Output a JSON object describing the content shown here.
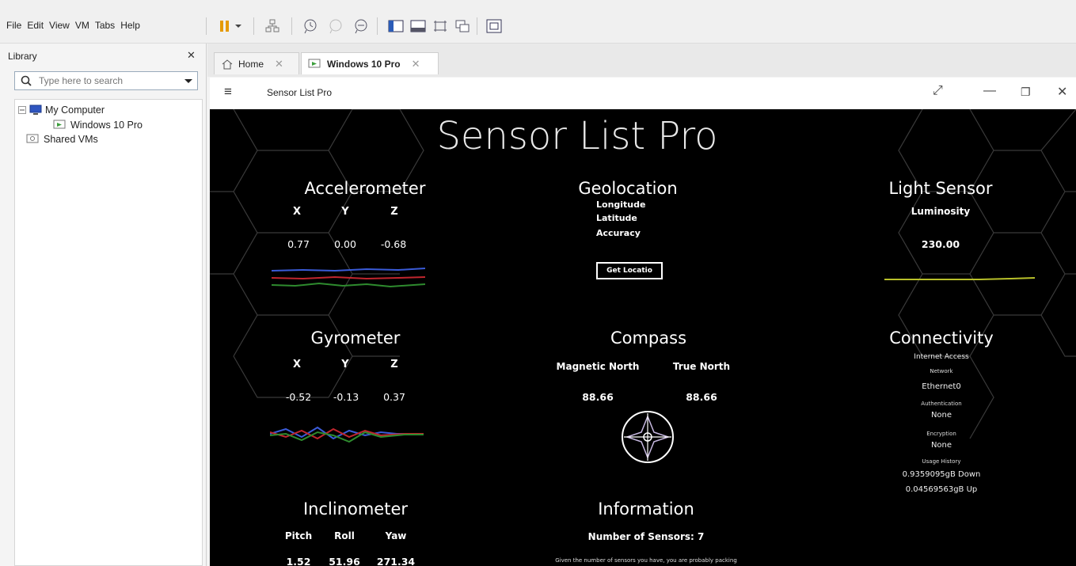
{
  "menubar": {
    "items": [
      "File",
      "Edit",
      "View",
      "VM",
      "Tabs",
      "Help"
    ]
  },
  "library": {
    "title": "Library",
    "search": {
      "placeholder": "Type here to search"
    },
    "tree": [
      {
        "label": "My Computer"
      },
      {
        "label": "Windows 10 Pro"
      },
      {
        "label": "Shared VMs"
      }
    ]
  },
  "tabs": [
    {
      "label": "Home"
    },
    {
      "label": "Windows 10 Pro"
    }
  ],
  "app": {
    "title_bar": {
      "name": "Sensor List Pro"
    },
    "heading": "Sensor List Pro",
    "accelerometer": {
      "title": "Accelerometer",
      "axes": [
        "X",
        "Y",
        "Z"
      ],
      "values": [
        "0.77",
        "0.00",
        "-0.68"
      ]
    },
    "geolocation": {
      "title": "Geolocation",
      "rows": [
        "Longitude",
        "Latitude",
        "Accuracy"
      ],
      "button": "Get Locatio"
    },
    "light": {
      "title": "Light Sensor",
      "label": "Luminosity",
      "value": "230.00"
    },
    "gyrometer": {
      "title": "Gyrometer",
      "axes": [
        "X",
        "Y",
        "Z"
      ],
      "values": [
        "-0.52",
        "-0.13",
        "0.37"
      ]
    },
    "compass": {
      "title": "Compass",
      "labels": [
        "Magnetic North",
        "True North"
      ],
      "values": [
        "88.66",
        "88.66"
      ]
    },
    "connectivity": {
      "title": "Connectivity",
      "internet": "Internet Access",
      "network_label": "Network",
      "network_value": "Ethernet0",
      "auth_label": "Authentication",
      "auth_value": "None",
      "enc_label": "Encryption",
      "enc_value": "None",
      "usage_label": "Usage History",
      "down": "0.9359095gB Down",
      "up": "0.04569563gB Up"
    },
    "inclinometer": {
      "title": "Inclinometer",
      "axes": [
        "Pitch",
        "Roll",
        "Yaw"
      ],
      "values": [
        "1.52",
        "51.96",
        "271.34"
      ]
    },
    "information": {
      "title": "Information",
      "count": "Number of Sensors: 7",
      "note": "Given the number of sensors you have, you are probably packing"
    }
  },
  "colors": {
    "accent_blue": "#3a5bd8",
    "accent_red": "#c0262e",
    "accent_green": "#2e8b2e",
    "light_yellow": "#b8c02a"
  }
}
